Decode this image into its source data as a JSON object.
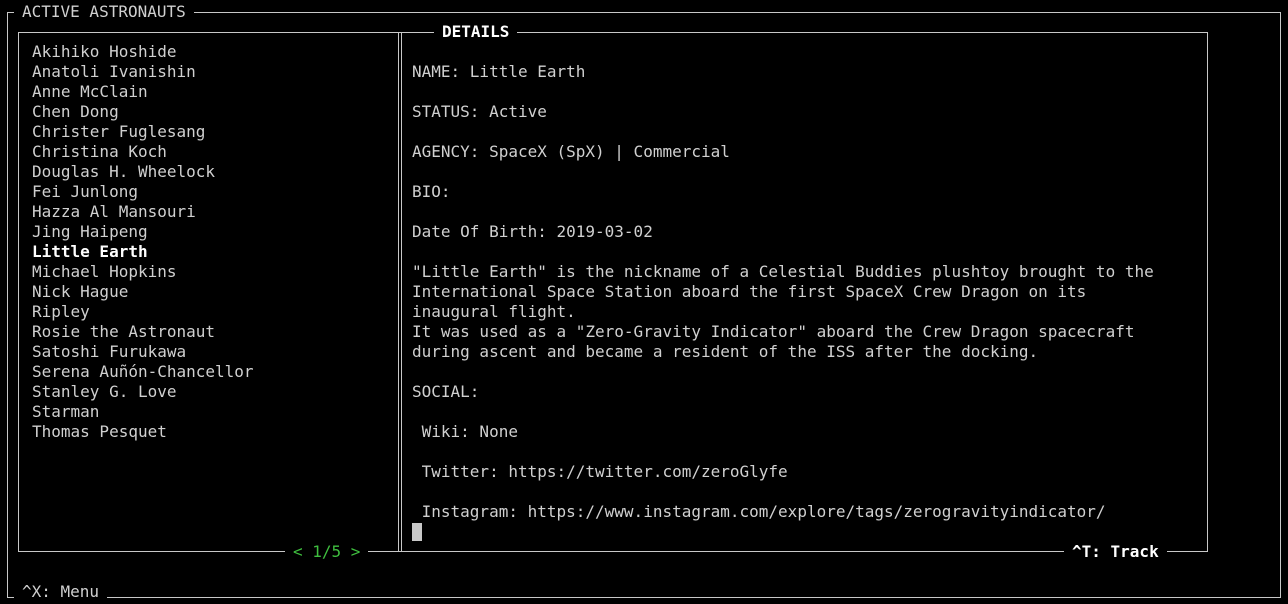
{
  "window": {
    "title": "ACTIVE ASTRONAUTS",
    "menu_hint": "^X: Menu"
  },
  "list": {
    "items": [
      "Akihiko Hoshide",
      "Anatoli Ivanishin",
      "Anne McClain",
      "Chen Dong",
      "Christer Fuglesang",
      "Christina Koch",
      "Douglas H. Wheelock",
      "Fei Junlong",
      "Hazza Al Mansouri",
      "Jing Haipeng",
      "Little Earth",
      "Michael Hopkins",
      "Nick Hague",
      "Ripley",
      "Rosie the Astronaut",
      "Satoshi Furukawa",
      "Serena Auñón-Chancellor",
      "Stanley G. Love",
      "Starman",
      "Thomas Pesquet"
    ],
    "selected": "Little Earth",
    "pager": "< 1/5 >"
  },
  "details": {
    "title": "DETAILS",
    "name": "NAME: Little Earth",
    "status": "STATUS: Active",
    "agency": "AGENCY: SpaceX (SpX) | Commercial",
    "bio_label": "BIO:",
    "dob": "Date Of Birth: 2019-03-02",
    "bio_lines": [
      "\"Little Earth\" is the nickname of a Celestial Buddies plushtoy brought to the",
      "International Space Station aboard the first SpaceX Crew Dragon on its",
      "inaugural flight.",
      "It was used as a \"Zero-Gravity Indicator\" aboard the Crew Dragon spacecraft",
      "during ascent and became a resident of the ISS after the docking."
    ],
    "social_label": "SOCIAL:",
    "wiki": " Wiki: None",
    "twitter": " Twitter: https://twitter.com/zeroGlyfe",
    "instagram": " Instagram: https://www.instagram.com/explore/tags/zerogravityindicator/",
    "track_hint": "^T: Track"
  }
}
